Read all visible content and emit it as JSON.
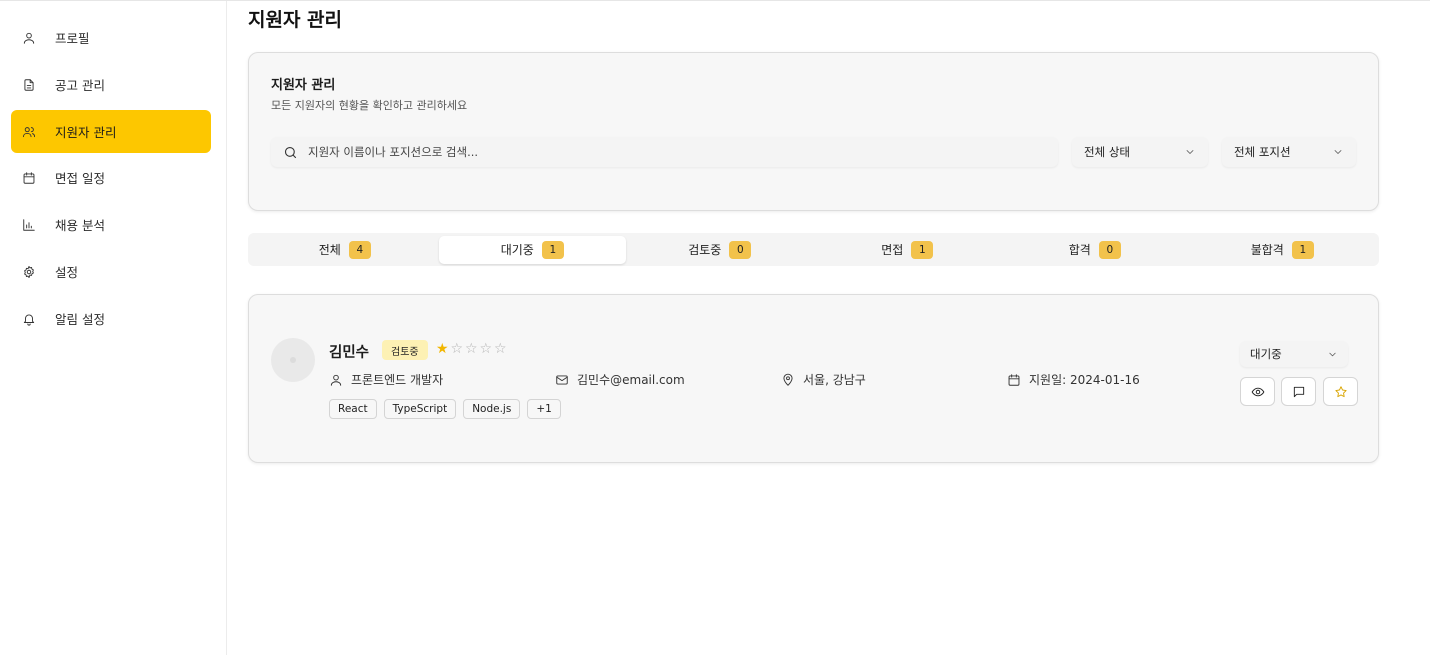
{
  "sidebar": {
    "items": [
      {
        "label": "프로필",
        "icon": "user-icon"
      },
      {
        "label": "공고 관리",
        "icon": "file-text-icon"
      },
      {
        "label": "지원자 관리",
        "icon": "users-icon",
        "active": true
      },
      {
        "label": "면접 일정",
        "icon": "calendar-icon"
      },
      {
        "label": "채용 분석",
        "icon": "bar-chart-icon"
      },
      {
        "label": "설정",
        "icon": "gear-icon"
      },
      {
        "label": "알림 설정",
        "icon": "bell-icon"
      }
    ]
  },
  "page": {
    "title": "지원자 관리"
  },
  "filter": {
    "title": "지원자 관리",
    "subtitle": "모든 지원자의 현황을 확인하고 관리하세요",
    "search_placeholder": "지원자 이름이나 포지션으로 검색...",
    "status_select": "전체 상태",
    "position_select": "전체 포지션"
  },
  "tabs": [
    {
      "label": "전체",
      "count": "4"
    },
    {
      "label": "대기중",
      "count": "1",
      "active": true
    },
    {
      "label": "검토중",
      "count": "0"
    },
    {
      "label": "면접",
      "count": "1"
    },
    {
      "label": "합격",
      "count": "0"
    },
    {
      "label": "불합격",
      "count": "1"
    }
  ],
  "applicant": {
    "name": "김민수",
    "status_badge": "검토중",
    "rating": 1,
    "rating_max": 5,
    "position": "프론트엔드 개발자",
    "email": "김민수@email.com",
    "location": "서울, 강남구",
    "applied_date": "지원일: 2024-01-16",
    "skills": [
      "React",
      "TypeScript",
      "Node.js",
      "+1"
    ],
    "stage_select": "대기중"
  },
  "colors": {
    "accent": "#fdc700",
    "count_badge": "#f2c24b",
    "status_badge_bg": "#fdf1b4",
    "star_filled": "#f2b600"
  }
}
